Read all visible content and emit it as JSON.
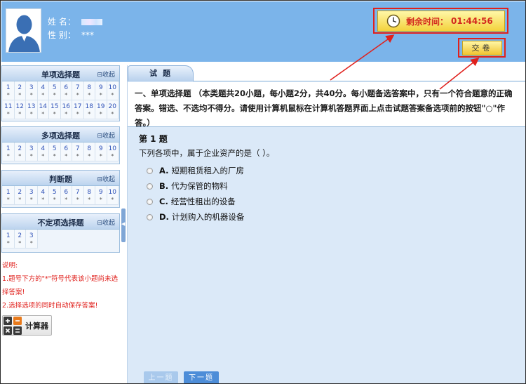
{
  "user": {
    "name_label": "姓    名：",
    "gender_label": "性    别：",
    "gender_value": "***"
  },
  "timer": {
    "label": "剩余时间：",
    "value": "01:44:56",
    "icon": "clock-icon"
  },
  "submit": {
    "label": "交卷"
  },
  "sections": [
    {
      "title": "单项选择题",
      "collapse": "⊟收起",
      "items": [
        {
          "n": "1",
          "s": "*"
        },
        {
          "n": "2",
          "s": "*"
        },
        {
          "n": "3",
          "s": "*"
        },
        {
          "n": "4",
          "s": "*"
        },
        {
          "n": "5",
          "s": "*"
        },
        {
          "n": "6",
          "s": "*"
        },
        {
          "n": "7",
          "s": "*"
        },
        {
          "n": "8",
          "s": "*"
        },
        {
          "n": "9",
          "s": "*"
        },
        {
          "n": "10",
          "s": "*"
        },
        {
          "n": "11",
          "s": "*"
        },
        {
          "n": "12",
          "s": "*"
        },
        {
          "n": "13",
          "s": "*"
        },
        {
          "n": "14",
          "s": "*"
        },
        {
          "n": "15",
          "s": "*"
        },
        {
          "n": "16",
          "s": "*"
        },
        {
          "n": "17",
          "s": "*"
        },
        {
          "n": "18",
          "s": "*"
        },
        {
          "n": "19",
          "s": "*"
        },
        {
          "n": "20",
          "s": "*"
        }
      ]
    },
    {
      "title": "多项选择题",
      "collapse": "⊟收起",
      "items": [
        {
          "n": "1",
          "s": "*"
        },
        {
          "n": "2",
          "s": "*"
        },
        {
          "n": "3",
          "s": "*"
        },
        {
          "n": "4",
          "s": "*"
        },
        {
          "n": "5",
          "s": "*"
        },
        {
          "n": "6",
          "s": "*"
        },
        {
          "n": "7",
          "s": "*"
        },
        {
          "n": "8",
          "s": "*"
        },
        {
          "n": "9",
          "s": "*"
        },
        {
          "n": "10",
          "s": "*"
        }
      ]
    },
    {
      "title": "判断题",
      "collapse": "⊟收起",
      "items": [
        {
          "n": "1",
          "s": "*"
        },
        {
          "n": "2",
          "s": "*"
        },
        {
          "n": "3",
          "s": "*"
        },
        {
          "n": "4",
          "s": "*"
        },
        {
          "n": "5",
          "s": "*"
        },
        {
          "n": "6",
          "s": "*"
        },
        {
          "n": "7",
          "s": "*"
        },
        {
          "n": "8",
          "s": "*"
        },
        {
          "n": "9",
          "s": "*"
        },
        {
          "n": "10",
          "s": "*"
        }
      ]
    },
    {
      "title": "不定项选择题",
      "collapse": "⊟收起",
      "items": [
        {
          "n": "1",
          "s": "*"
        },
        {
          "n": "2",
          "s": "*"
        },
        {
          "n": "3",
          "s": "*"
        }
      ]
    }
  ],
  "notes": {
    "title": "说明:",
    "line1": "1.题号下方的\"*\"符号代表该小题尚未选择答案!",
    "line2": "2.选择选项的同时自动保存答案!"
  },
  "calculator": {
    "label": "计算器",
    "icon": "calculator-icon"
  },
  "tab": {
    "label": "试题"
  },
  "instructions": "一、单项选择题 （本类题共20小题，每小题2分，共40分。每小题备选答案中，只有一个符合题意的正确答案。错选、不选均不得分。请使用计算机鼠标在计算机答题界面上点击试题答案备选项前的按钮\"○\"作答。）",
  "question": {
    "number": "第 1 题",
    "text": "下列各项中，属于企业资产的是（    ）。",
    "options": [
      {
        "key": "A.",
        "text": "短期租赁租入的厂房"
      },
      {
        "key": "B.",
        "text": "代为保管的物料"
      },
      {
        "key": "C.",
        "text": "经营性租出的设备"
      },
      {
        "key": "D.",
        "text": "计划购入的机器设备"
      }
    ]
  },
  "nav": {
    "prev": "上一题",
    "next": "下一题"
  },
  "colors": {
    "header": "#7bb4ea",
    "highlight": "#e0201c",
    "link": "#2e51b8"
  }
}
